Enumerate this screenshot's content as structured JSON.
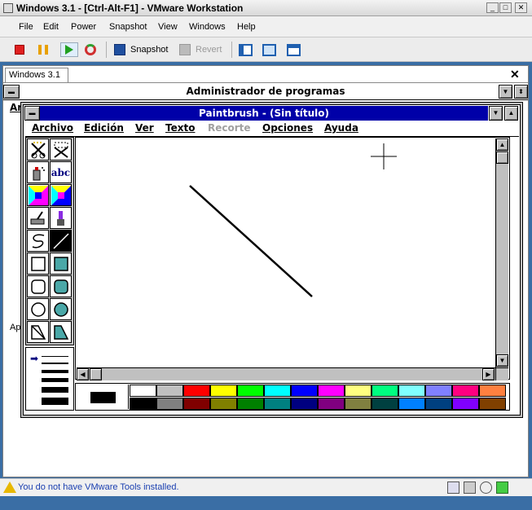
{
  "window": {
    "title": "Windows 3.1 - [Ctrl-Alt-F1] - VMware Workstation"
  },
  "vm_menu": [
    "File",
    "Edit",
    "Power",
    "Snapshot",
    "View",
    "Windows",
    "Help"
  ],
  "toolbar": {
    "snapshot_label": "Snapshot",
    "revert_label": "Revert"
  },
  "guest_tab": {
    "label": "Windows 3.1"
  },
  "program_manager": {
    "title": "Administrador de programas",
    "menu_partial": "Ar",
    "side_label": "Ap"
  },
  "paintbrush": {
    "title": "Paintbrush - (Sin título)",
    "menu": [
      {
        "label": "Archivo",
        "disabled": false
      },
      {
        "label": "Edición",
        "disabled": false
      },
      {
        "label": "Ver",
        "disabled": false
      },
      {
        "label": "Texto",
        "disabled": false
      },
      {
        "label": "Recorte",
        "disabled": true
      },
      {
        "label": "Opciones",
        "disabled": false
      },
      {
        "label": "Ayuda",
        "disabled": false
      }
    ],
    "tools": [
      "scissors-icon",
      "pick-icon",
      "airbrush-icon",
      "text-icon",
      "color-eraser-icon",
      "eraser-icon",
      "paint-roller-icon",
      "brush-icon",
      "curve-icon",
      "line-icon",
      "box-icon",
      "filled-box-icon",
      "rounded-box-icon",
      "filled-rounded-box-icon",
      "circle-icon",
      "filled-circle-icon",
      "polygon-icon",
      "filled-polygon-icon"
    ],
    "text_tool_glyph": "abc",
    "palette_top": [
      "#ffffff",
      "#c0c0c0",
      "#ff0000",
      "#ffff00",
      "#00ff00",
      "#00ffff",
      "#0000ff",
      "#ff00ff",
      "#ffff80",
      "#00ff80",
      "#80ffff",
      "#8080ff",
      "#ff0080",
      "#ff8040"
    ],
    "palette_bottom": [
      "#000000",
      "#808080",
      "#800000",
      "#808000",
      "#008000",
      "#008080",
      "#000080",
      "#800080",
      "#808040",
      "#004040",
      "#0080ff",
      "#004080",
      "#8000ff",
      "#804000"
    ]
  },
  "status": {
    "message": "You do not have VMware Tools installed."
  },
  "colors": {
    "win31_title": "#0000a8",
    "face": "#c0c0c0"
  }
}
